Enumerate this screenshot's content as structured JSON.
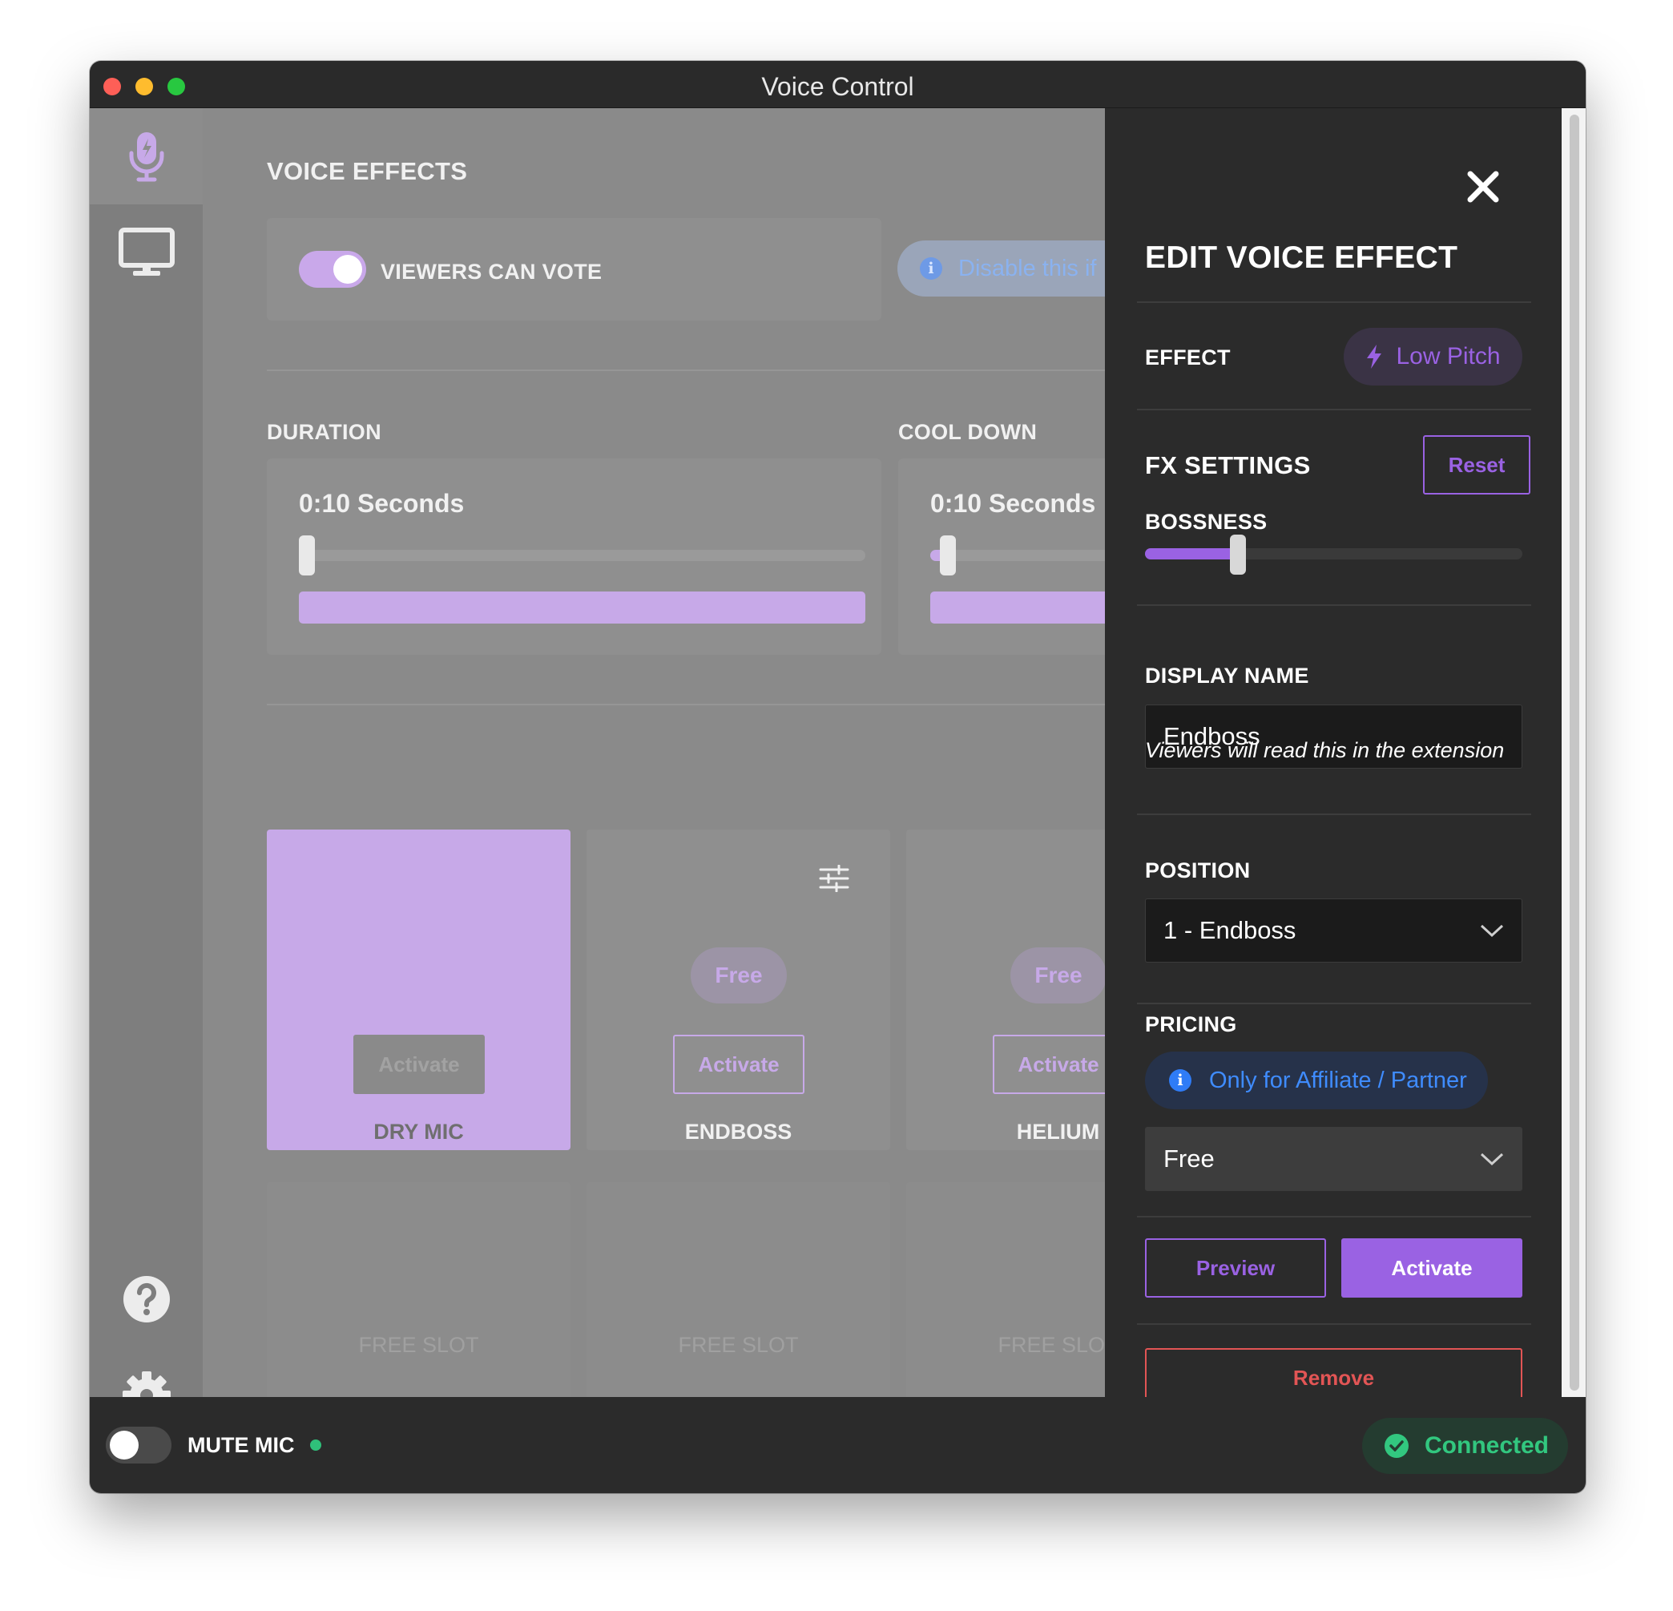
{
  "window": {
    "title": "Voice Control"
  },
  "sidebar": {
    "items": [
      {
        "icon": "microphone-icon",
        "active": true
      },
      {
        "icon": "monitor-icon",
        "active": false
      }
    ],
    "bottom_icons": [
      "help-icon",
      "gear-icon"
    ]
  },
  "main": {
    "section_title": "VOICE EFFECTS",
    "viewers_vote": {
      "label": "VIEWERS CAN VOTE",
      "enabled": true
    },
    "info_text": "Disable this if",
    "duration": {
      "label": "DURATION",
      "value": "0:10 Seconds",
      "slider": 0.0
    },
    "cooldown": {
      "label": "COOL DOWN",
      "value": "0:10 Seconds",
      "slider": 0.03
    },
    "effects": [
      {
        "name": "DRY MIC",
        "button": "Activate",
        "active": true
      },
      {
        "name": "ENDBOSS",
        "button": "Activate",
        "price": "Free",
        "settings_icon": "sliders-icon"
      },
      {
        "name": "HELIUM",
        "button": "Activate",
        "price": "Free"
      }
    ],
    "slots": [
      "FREE SLOT",
      "FREE SLOT",
      "FREE SLOT"
    ]
  },
  "edit_panel": {
    "title": "EDIT VOICE EFFECT",
    "effect_label": "EFFECT",
    "effect_value": "Low Pitch",
    "fx_settings_label": "FX SETTINGS",
    "reset_label": "Reset",
    "bossness_label": "BOSSNESS",
    "bossness_value": 0.2,
    "display_name_label": "DISPLAY NAME",
    "display_name_value": "Endboss",
    "display_name_hint": "Viewers will read this in the extension",
    "position_label": "POSITION",
    "position_value": "1 - Endboss",
    "pricing_label": "PRICING",
    "pricing_info": "Only for Affiliate / Partner",
    "pricing_value": "Free",
    "preview_label": "Preview",
    "activate_label": "Activate",
    "remove_label": "Remove"
  },
  "bottom_bar": {
    "mute_label": "MUTE MIC",
    "mute_enabled": false,
    "status": "Connected"
  },
  "colors": {
    "accent": "#9a62e3",
    "accent_light": "#c7a9e8",
    "danger": "#e25555",
    "success": "#32c77f",
    "info": "#3f8cff"
  }
}
